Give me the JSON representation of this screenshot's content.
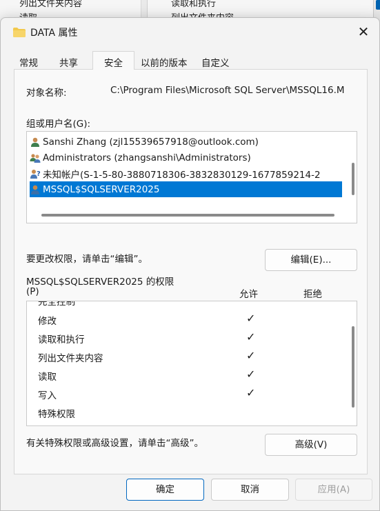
{
  "background": {
    "left_items": [
      "列出文件夹内容",
      "读取"
    ],
    "mid_items": [
      "读取和执行",
      "列出文件夹内容"
    ]
  },
  "dialog": {
    "title": "DATA 属性",
    "close_icon": "close-icon",
    "tabs": [
      {
        "label": "常规",
        "active": false
      },
      {
        "label": "共享",
        "active": false
      },
      {
        "label": "安全",
        "active": true
      },
      {
        "label": "以前的版本",
        "active": false
      },
      {
        "label": "自定义",
        "active": false
      }
    ],
    "object_name_label": "对象名称:",
    "object_name_value": "C:\\Program Files\\Microsoft SQL Server\\MSSQL16.M",
    "users_label": "组或用户名(G):",
    "users": [
      {
        "name": "Sanshi Zhang (zjl15539657918@outlook.com)",
        "icon": "user-icon",
        "selected": false
      },
      {
        "name": "Administrators (zhangsanshi\\Administrators)",
        "icon": "group-icon",
        "selected": false
      },
      {
        "name": "未知帐户(S-1-5-80-3880718306-3832830129-1677859214-2",
        "icon": "unknown-user-icon",
        "selected": false
      },
      {
        "name": "MSSQL$SQLSERVER2025",
        "icon": "user-icon",
        "selected": true
      }
    ],
    "edit_hint": "要更改权限，请单击“编辑”。",
    "edit_button": "编辑(E)...",
    "perm_title_line1": "MSSQL$SQLSERVER2025 的权限",
    "perm_title_line2": "(P)",
    "allow_header": "允许",
    "deny_header": "拒绝",
    "permissions": [
      {
        "name": "完全控制",
        "allow": false,
        "deny": false
      },
      {
        "name": "修改",
        "allow": true,
        "deny": false
      },
      {
        "name": "读取和执行",
        "allow": true,
        "deny": false
      },
      {
        "name": "列出文件夹内容",
        "allow": true,
        "deny": false
      },
      {
        "name": "读取",
        "allow": true,
        "deny": false
      },
      {
        "name": "写入",
        "allow": true,
        "deny": false
      },
      {
        "name": "特殊权限",
        "allow": false,
        "deny": false
      }
    ],
    "check_mark": "✓",
    "advanced_hint": "有关特殊权限或高级设置，请单击“高级”。",
    "advanced_button": "高级(V)",
    "ok_button": "确定",
    "cancel_button": "取消",
    "apply_button": "应用(A)"
  },
  "colors": {
    "selection": "#0078d4",
    "primary_border": "#0067c0",
    "folder": "#f2c94c"
  }
}
